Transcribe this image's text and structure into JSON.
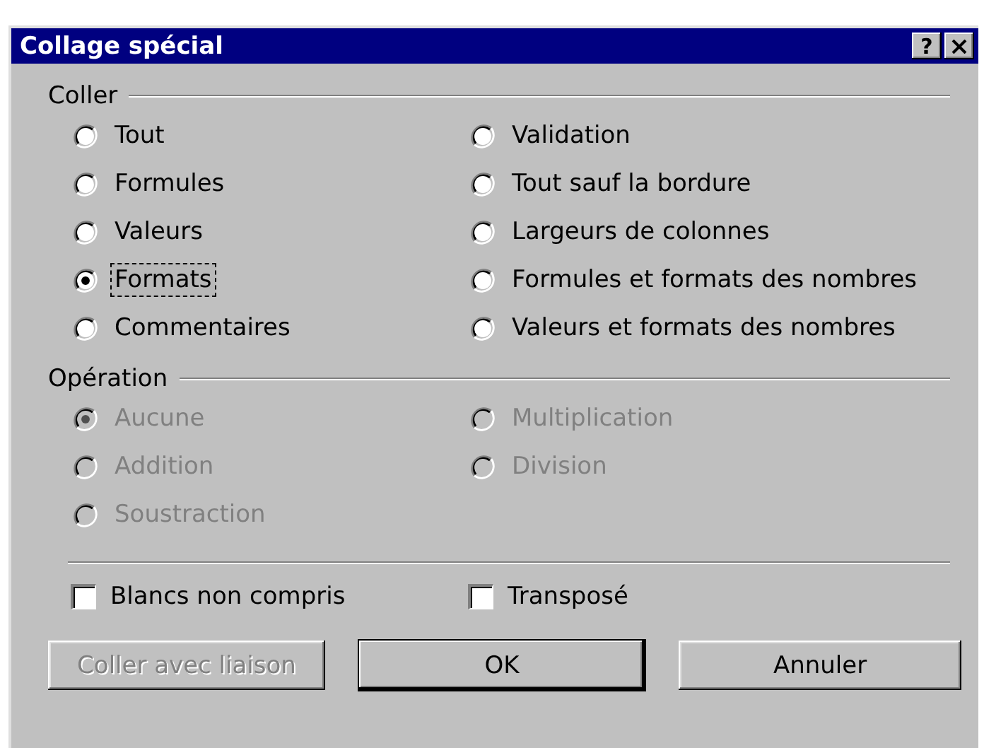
{
  "window": {
    "title": "Collage spécial",
    "help_button": "?"
  },
  "groups": [
    {
      "title": "Coller",
      "options": [
        {
          "label": "Tout",
          "selected": false,
          "disabled": false,
          "focused": false
        },
        {
          "label": "Formules",
          "selected": false,
          "disabled": false,
          "focused": false
        },
        {
          "label": "Valeurs",
          "selected": false,
          "disabled": false,
          "focused": false
        },
        {
          "label": "Formats",
          "selected": true,
          "disabled": false,
          "focused": true
        },
        {
          "label": "Commentaires",
          "selected": false,
          "disabled": false,
          "focused": false
        },
        {
          "label": "Validation",
          "selected": false,
          "disabled": false,
          "focused": false
        },
        {
          "label": "Tout sauf la bordure",
          "selected": false,
          "disabled": false,
          "focused": false
        },
        {
          "label": "Largeurs de colonnes",
          "selected": false,
          "disabled": false,
          "focused": false
        },
        {
          "label": "Formules et formats des nombres",
          "selected": false,
          "disabled": false,
          "focused": false
        },
        {
          "label": "Valeurs et formats des nombres",
          "selected": false,
          "disabled": false,
          "focused": false
        }
      ]
    },
    {
      "title": "Opération",
      "options": [
        {
          "label": "Aucune",
          "selected": true,
          "disabled": true,
          "focused": false
        },
        {
          "label": "Addition",
          "selected": false,
          "disabled": true,
          "focused": false
        },
        {
          "label": "Soustraction",
          "selected": false,
          "disabled": true,
          "focused": false
        },
        {
          "label": "Multiplication",
          "selected": false,
          "disabled": true,
          "focused": false
        },
        {
          "label": "Division",
          "selected": false,
          "disabled": true,
          "focused": false
        }
      ]
    }
  ],
  "checkboxes": [
    {
      "label": "Blancs non compris",
      "checked": false
    },
    {
      "label": "Transposé",
      "checked": false
    }
  ],
  "buttons": [
    {
      "label": "Coller avec liaison",
      "disabled": true,
      "default": false
    },
    {
      "label": "OK",
      "disabled": false,
      "default": true
    },
    {
      "label": "Annuler",
      "disabled": false,
      "default": false
    }
  ]
}
